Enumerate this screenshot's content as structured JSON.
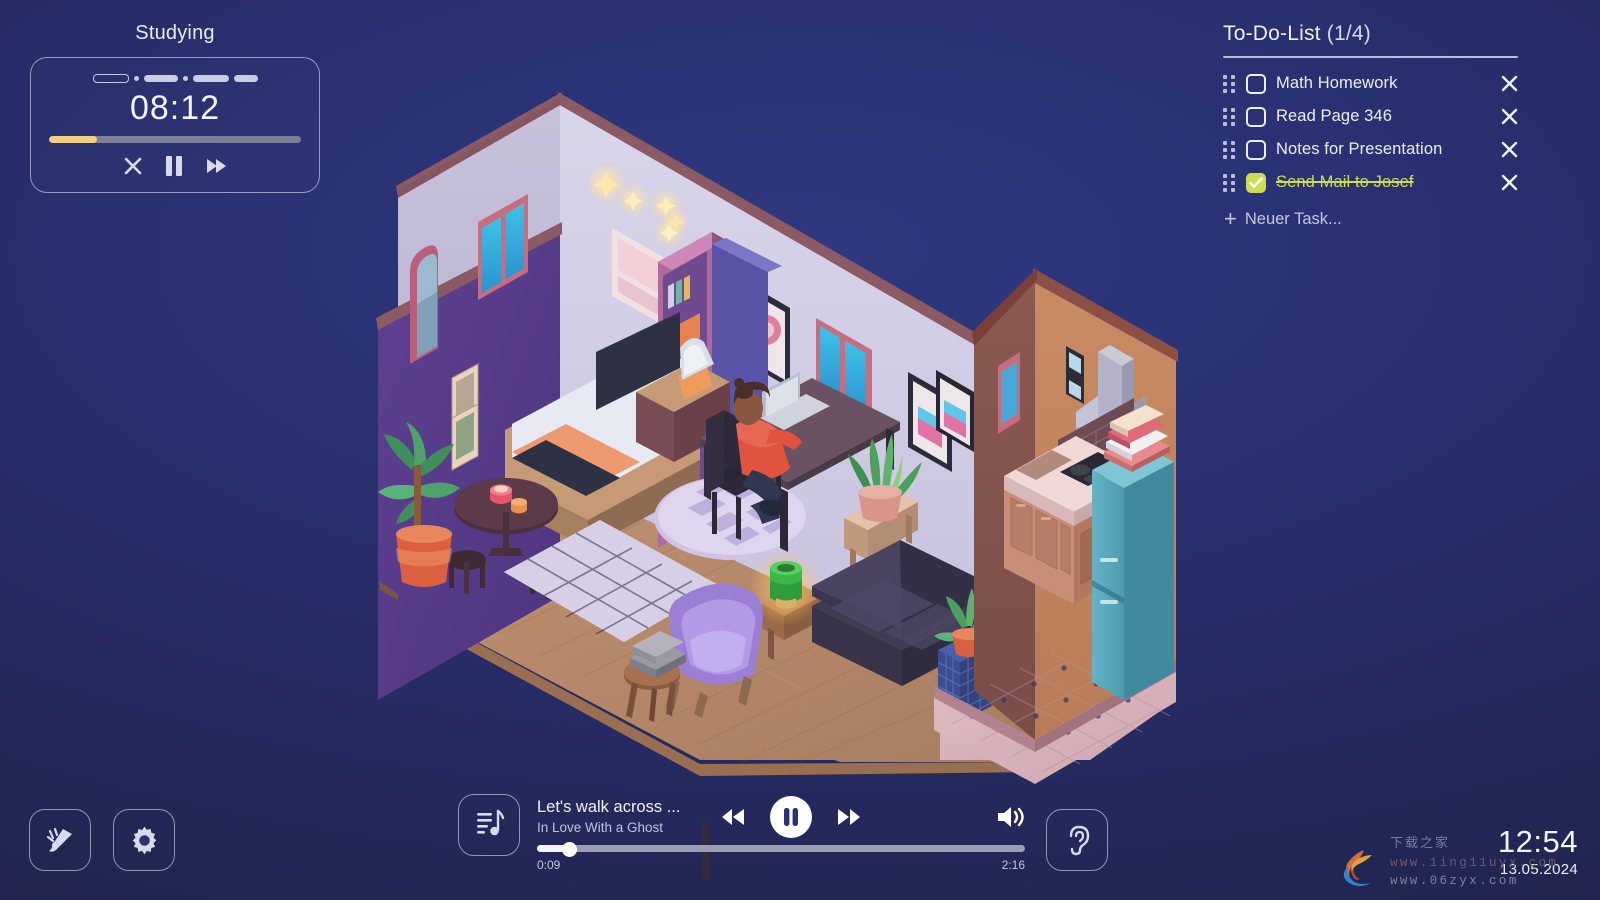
{
  "timer": {
    "label": "Studying",
    "time": "08:12",
    "progress_percent": 19,
    "segments": [
      "open",
      "dot",
      "filled",
      "dot",
      "filled",
      "filled"
    ],
    "buttons": {
      "close": "close-timer",
      "pause": "pause-timer",
      "skip": "skip-timer"
    }
  },
  "todo": {
    "title": "To-Do-List",
    "count": "(1/4)",
    "items": [
      {
        "label": "Math Homework",
        "done": false
      },
      {
        "label": "Read Page 346",
        "done": false
      },
      {
        "label": "Notes for Presentation",
        "done": false
      },
      {
        "label": "Send Mail to Josef",
        "done": true
      }
    ],
    "add_label": "Neuer Task...",
    "add_plus": "+",
    "done_color": "#cade4e"
  },
  "player": {
    "track_title": "Let's walk across ...",
    "track_artist": "In Love With a Ghost",
    "elapsed": "0:09",
    "duration": "2:16",
    "progress_percent": 6.6,
    "state": "playing"
  },
  "bottom_left": {
    "theme_button": "theme-brush",
    "settings_button": "settings-gear"
  },
  "ambient": {
    "button": "ambient-sounds-ear"
  },
  "clock": {
    "time": "12:54",
    "date": "13.05.2024"
  },
  "watermark": {
    "cn_text": "下载之家",
    "url1": "www.1ing11uyx.com",
    "url2": "www.06zyx.com"
  },
  "colors": {
    "background_center": "#2a3275",
    "background_edge": "#1e2249",
    "timer_accent": "#f3cf85",
    "checked_accent": "#cade4e",
    "text_primary": "#eceef8",
    "text_muted": "#bfc4db"
  }
}
